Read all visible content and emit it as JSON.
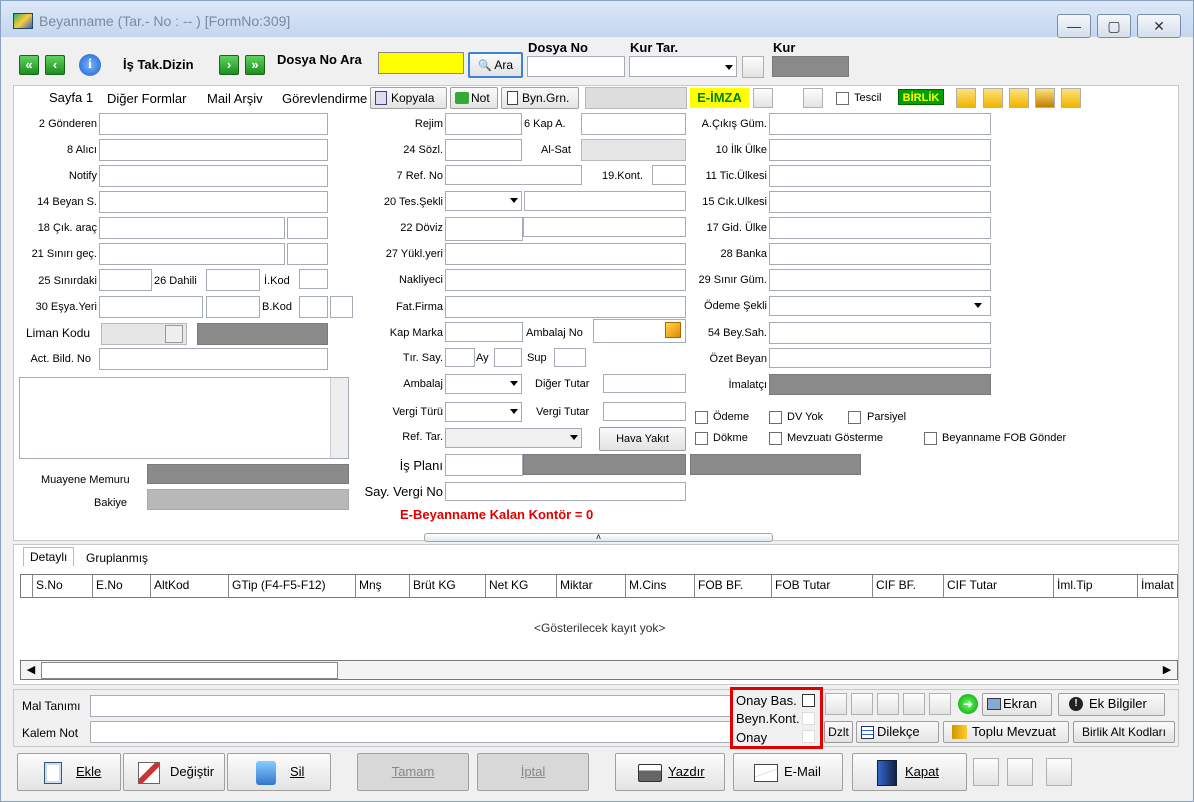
{
  "window": {
    "title": "Beyanname (Tar.- No : --  )  [FormNo:309]"
  },
  "toolbar": {
    "is_tak_dizin": "İş Tak.Dizin",
    "dosya_no_ara": "Dosya No Ara",
    "ara_button": "Ara",
    "dosya_no_label": "Dosya No",
    "kur_tar_label": "Kur Tar.",
    "kur_label": "Kur"
  },
  "tabs": {
    "sayfa1": "Sayfa 1",
    "diger_formlar": "Diğer Formlar",
    "mail_arsiv": "Mail Arşiv",
    "gorevlendirme": "Görevlendirme",
    "kopyala": "Kopyala",
    "not": "Not",
    "byn_grn": "Byn.Grn.",
    "e_imza": "E-İMZA",
    "tescil": "Tescil",
    "birlik": "BİRLİK"
  },
  "left": {
    "gonderen": "2 Gönderen",
    "alici": "8 Alıcı",
    "notify": "Notify",
    "beyan_s": "14 Beyan S.",
    "cik_arac": "18 Çık. araç",
    "sinir_gec": "21 Sınırı geç.",
    "sinirdaki": "25 Sınırdaki",
    "dahili": "26 Dahili",
    "i_kod": "İ.Kod",
    "esya_yeri": "30 Eşya.Yeri",
    "b_kod": "B.Kod",
    "liman_kodu": "Liman Kodu",
    "act_bild_no": "Act. Bild. No",
    "muayene_memuru": "Muayene Memuru",
    "bakiye": "Bakiye"
  },
  "middle": {
    "rejim": "Rejim",
    "kap_a": "6 Kap A.",
    "sozl": "24 Sözl.",
    "al_sat": "Al-Sat",
    "ref_no": "7 Ref. No",
    "kont": "19.Kont.",
    "tes_sekli": "20 Tes.Şekli",
    "doviz": "22 Döviz",
    "yukl_yeri": "27 Yükl.yeri",
    "nakliyeci": "Nakliyeci",
    "fat_firma": "Fat.Firma",
    "kap_marka": "Kap Marka",
    "ambalaj_no": "Ambalaj No",
    "tir_say": "Tır. Say.",
    "ay": "Ay",
    "sup": "Sup",
    "ambalaj": "Ambalaj",
    "diger_tutar": "Diğer Tutar",
    "vergi_turu": "Vergi Türü",
    "vergi_tutar": "Vergi Tutar",
    "ref_tar": "Ref. Tar.",
    "hava_yakit": "Hava Yakıt",
    "is_plani": "İş Planı",
    "say_vergi_no": "Say. Vergi No",
    "kontor": "E-Beyanname Kalan Kontör = 0"
  },
  "right": {
    "a_cikis_gum": "A.Çıkış Güm.",
    "ilk_ulke": "10 İlk Ülke",
    "tic_ulkesi": "11 Tic.Ülkesi",
    "cik_ulkesi": "15 Cık.Ulkesi",
    "gid_ulke": "17 Gid. Ülke",
    "banka": "28 Banka",
    "sinir_gum": "29 Sınır Güm.",
    "odeme_sekli": "Ödeme Şekli",
    "bey_sah": "54 Bey.Sah.",
    "ozet_beyan": "Özet Beyan",
    "imalatci": "İmalatçı",
    "odeme": "Ödeme",
    "dv_yok": "DV Yok",
    "parsiyel": "Parsiyel",
    "dokme": "Dökme",
    "mevzuati_gosterme": "Mevzuatı Gösterme",
    "fob_gonder": "Beyanname FOB Gönder"
  },
  "grid": {
    "tab_detayli": "Detaylı",
    "tab_gruplanmis": "Gruplanmış",
    "columns": [
      "S.No",
      "E.No",
      "AltKod",
      "GTip (F4-F5-F12)",
      "Mnş",
      "Brüt KG",
      "Net KG",
      "Miktar",
      "M.Cins",
      "FOB BF.",
      "FOB Tutar",
      "CIF BF.",
      "CIF Tutar",
      "İml.Tip",
      "İmalat"
    ],
    "empty": "<Gösterilecek kayıt yok>"
  },
  "bottom": {
    "mal_tanimi": "Mal Tanımı",
    "kalem_not": "Kalem Not",
    "onay_bas": "Onay Bas.",
    "beyn_kont": "Beyn.Kont.",
    "onay": "Onay",
    "ekran": "Ekran",
    "ek_bilgiler": "Ek Bilgiler",
    "dzlt": "Dzlt",
    "dilekce": "Dilekçe",
    "toplu_mevzuat": "Toplu Mevzuat",
    "birlik_alt_kodlari": "Birlik Alt Kodları"
  },
  "actions": {
    "ekle": "Ekle",
    "degistir": "Değiştir",
    "sil": "Sil",
    "tamam": "Tamam",
    "iptal": "İptal",
    "yazdir": "Yazdır",
    "email": "E-Mail",
    "kapat": "Kapat"
  },
  "colors": {
    "highlight_red": "#e00000",
    "yellow_field": "#ffff00",
    "e_imza_bg": "#ffff00",
    "birlik_bg": "#00a000"
  }
}
